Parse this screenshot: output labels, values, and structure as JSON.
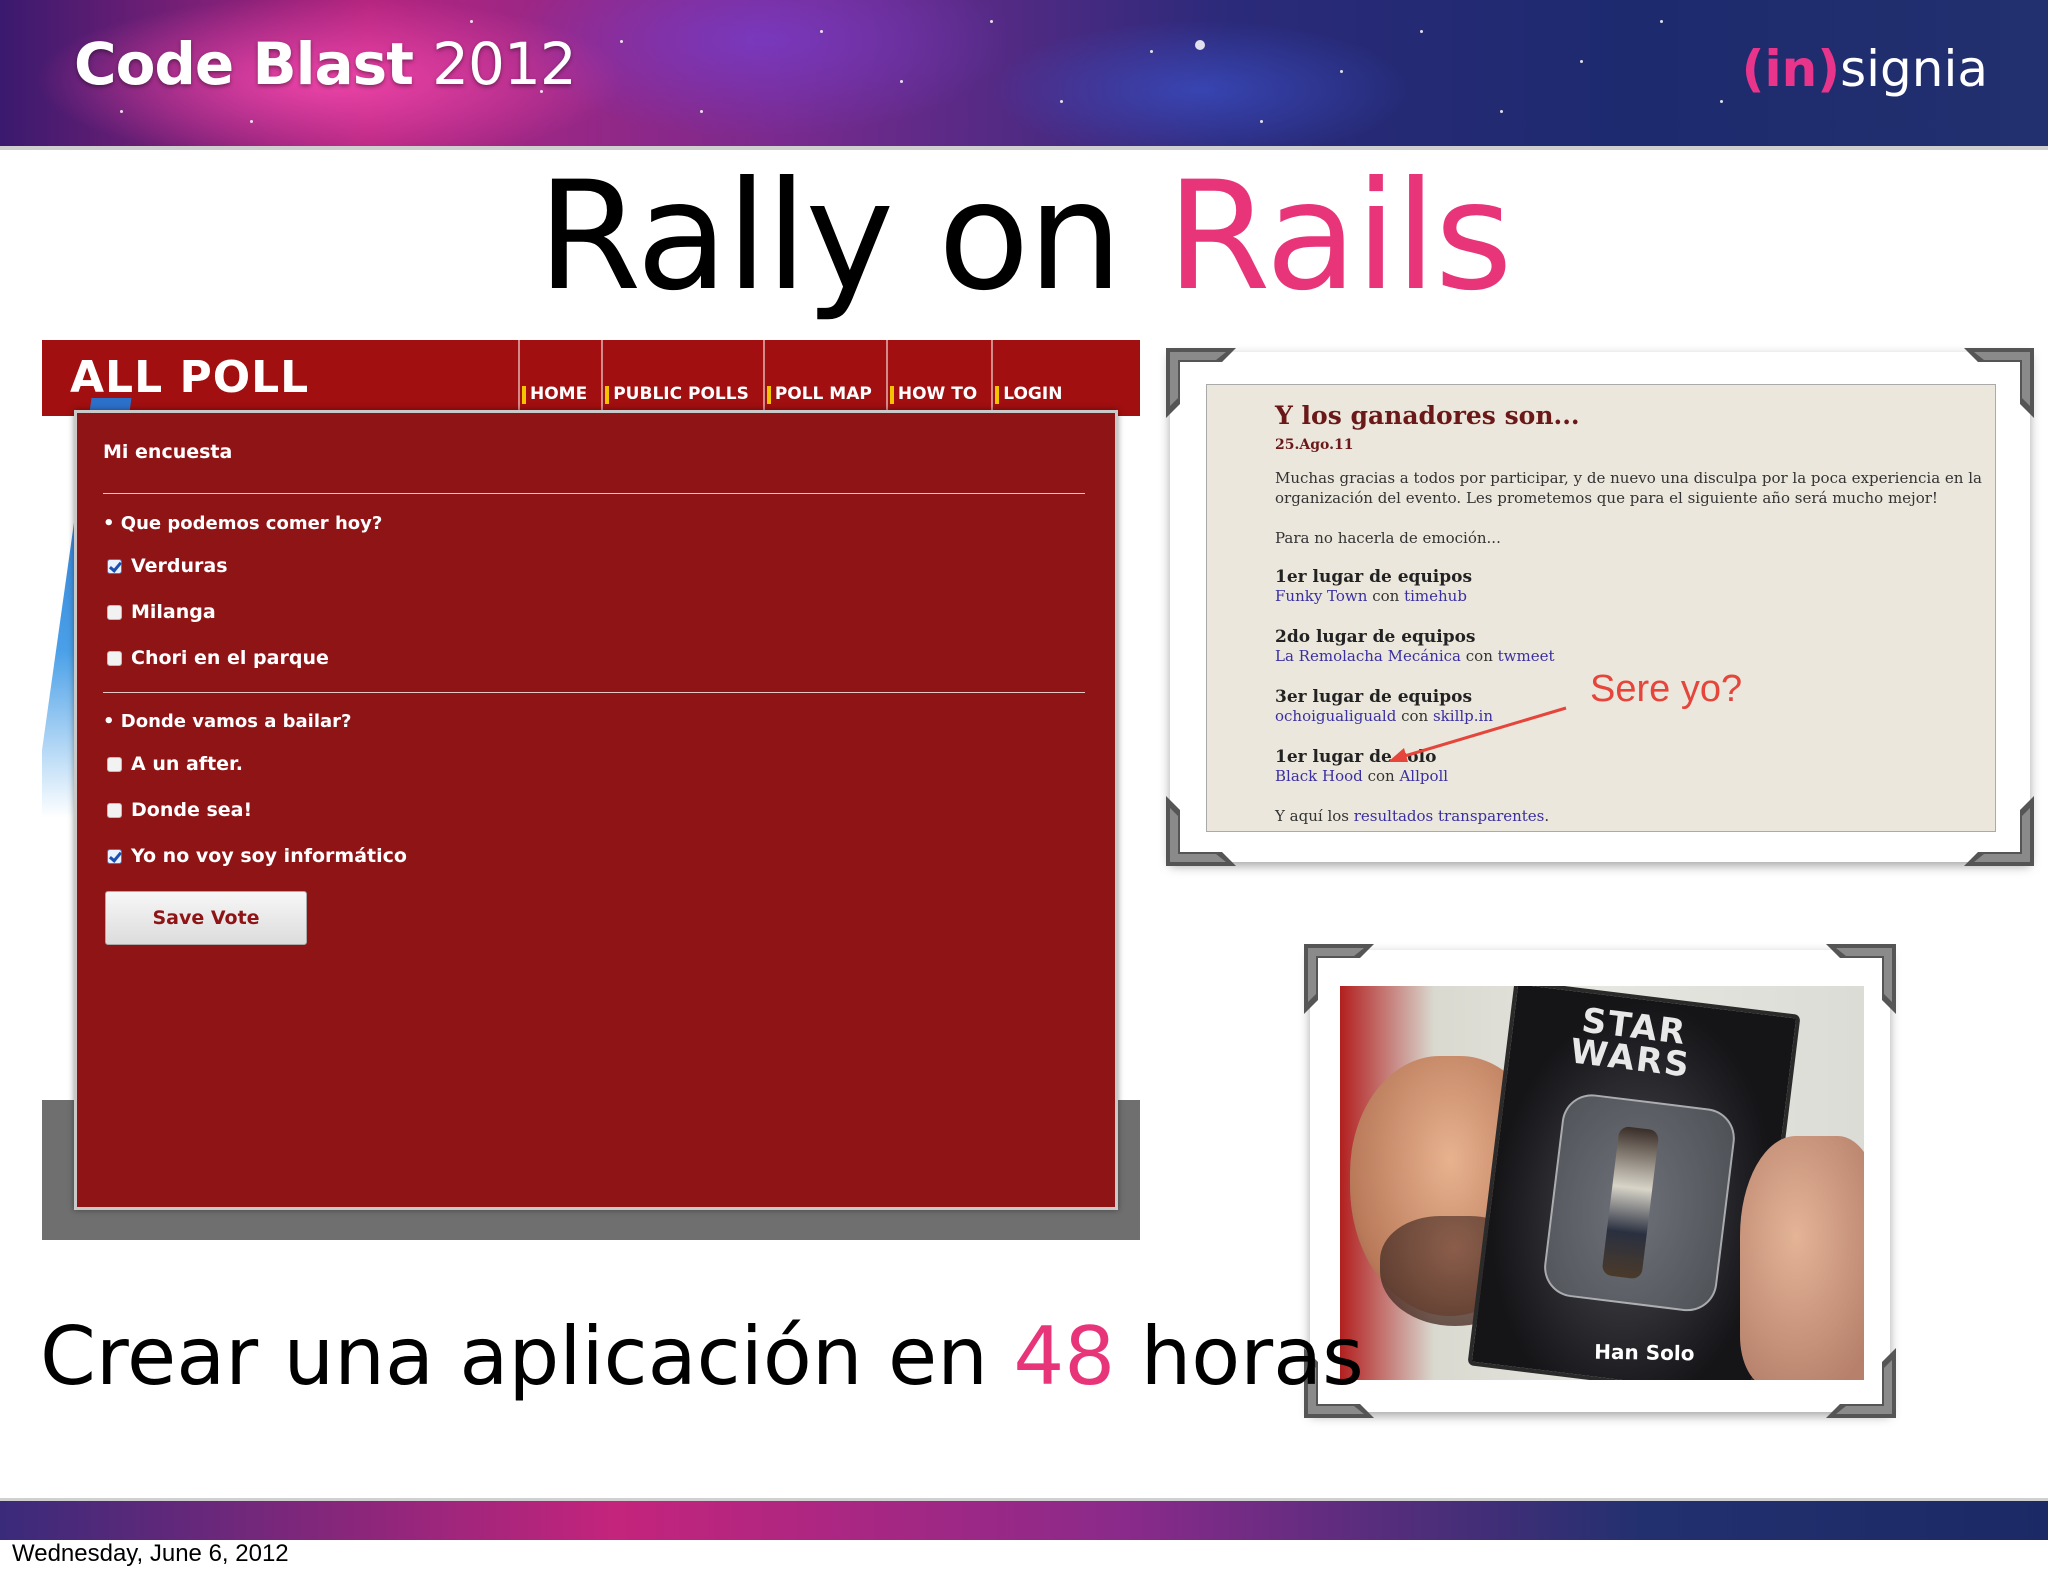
{
  "header": {
    "logo_main": "Code Blast",
    "logo_year": "2012",
    "brand_open": "(in)",
    "brand_rest": "signia"
  },
  "title": {
    "part1": "Rally on",
    "part2": "Rails"
  },
  "subtitle": {
    "part1": "Crear una aplicación en",
    "accent": "48",
    "part2": "horas"
  },
  "poll_app": {
    "logo": "ALL POLL",
    "nav": [
      "HOME",
      "PUBLIC POLLS",
      "POLL MAP",
      "HOW TO",
      "LOGIN"
    ],
    "poll_title": "Mi encuesta",
    "q1": "• Que podemos comer hoy?",
    "q1_options": [
      {
        "label": "Verduras",
        "checked": true
      },
      {
        "label": "Milanga",
        "checked": false
      },
      {
        "label": "Chori en el parque",
        "checked": false
      }
    ],
    "q2": "• Donde vamos a bailar?",
    "q2_options": [
      {
        "label": "A un after.",
        "checked": false
      },
      {
        "label": "Donde sea!",
        "checked": false
      },
      {
        "label": "Yo no voy soy informático",
        "checked": true
      }
    ],
    "save_button": "Save Vote",
    "colors": {
      "bar": "#a10f10",
      "panel": "#8e1416",
      "nav_marker": "#f5c400"
    }
  },
  "blog": {
    "title": "Y los ganadores son...",
    "date": "25.Ago.11",
    "intro_line1": "Muchas gracias a todos por participar, y de nuevo una disculpa por la poca experiencia en la",
    "intro_line2": "organización del evento. Les prometemos que para el siguiente año será mucho mejor!",
    "lead": "Para no hacerla de emoción...",
    "places": [
      {
        "heading": "1er lugar de equipos",
        "team": "Funky Town",
        "sep": "con",
        "app": "timehub"
      },
      {
        "heading": "2do lugar de equipos",
        "team": "La Remolacha Mecánica",
        "sep": "con",
        "app": "twmeet"
      },
      {
        "heading": "3er lugar de equipos",
        "team": "ochoigualiguald",
        "sep": "con",
        "app": "skillp.in"
      },
      {
        "heading": "1er lugar de solo",
        "team": "Black Hood",
        "sep": "con",
        "app": "Allpoll"
      }
    ],
    "closing_prefix": "Y aquí los",
    "closing_link": "resultados transparentes",
    "closing_suffix": "."
  },
  "annotation": "Sere yo?",
  "photo": {
    "box_logo_line1": "STAR",
    "box_logo_line2": "WARS",
    "box_name": "Han Solo"
  },
  "footer": {
    "date": "Wednesday, June 6, 2012"
  }
}
